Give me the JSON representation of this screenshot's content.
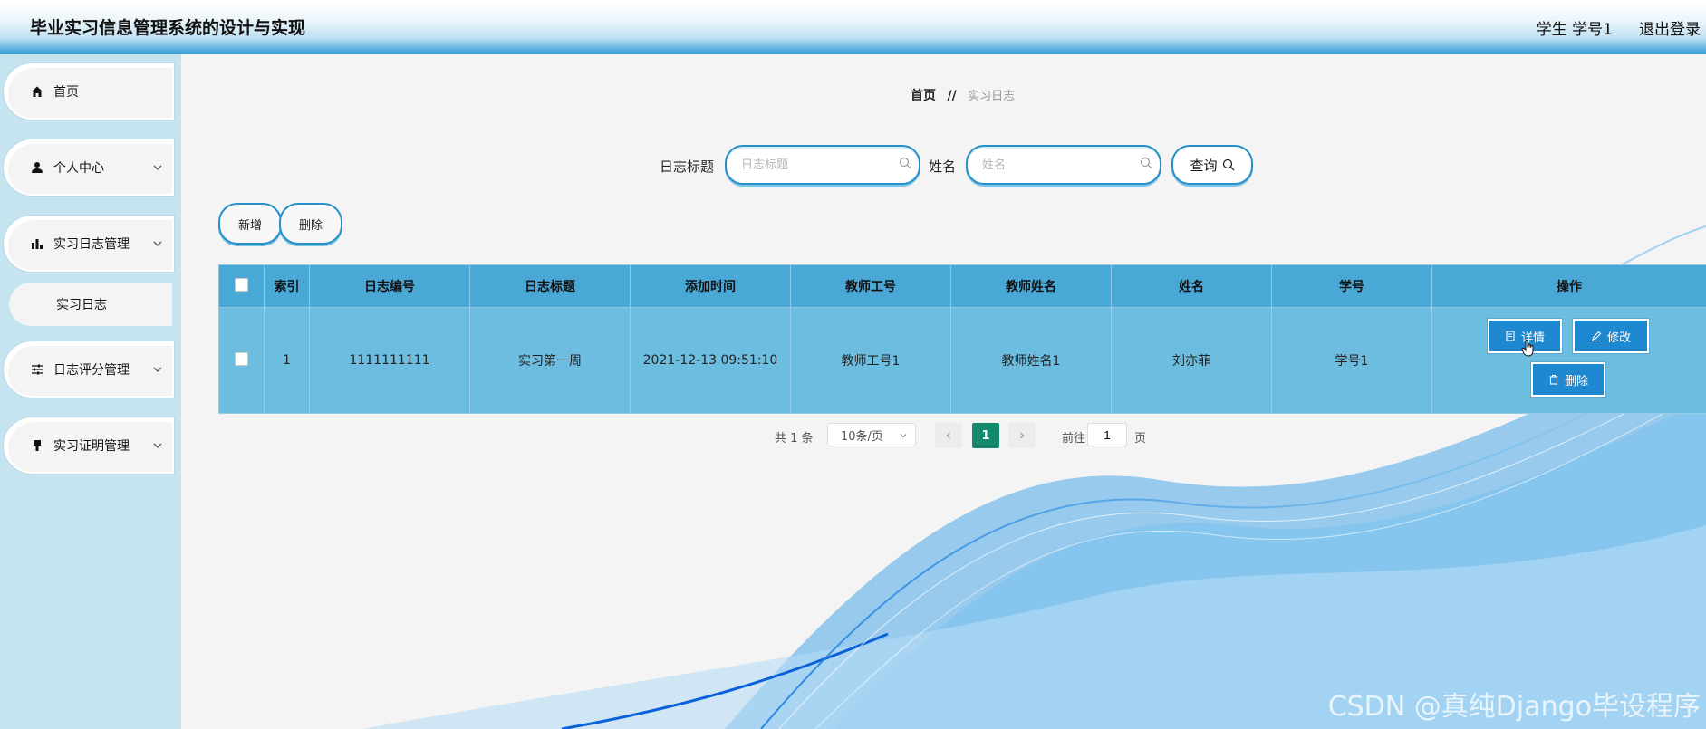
{
  "header": {
    "title": "毕业实习信息管理系统的设计与实现",
    "user": "学生 学号1",
    "logout": "退出登录"
  },
  "sidebar": {
    "items": [
      {
        "label": "首页",
        "icon": "home-icon"
      },
      {
        "label": "个人中心",
        "icon": "user-icon"
      },
      {
        "label": "实习日志管理",
        "icon": "bar-chart-icon"
      },
      {
        "label": "日志评分管理",
        "icon": "sliders-icon"
      },
      {
        "label": "实习证明管理",
        "icon": "stamp-icon"
      }
    ],
    "sub_item": "实习日志"
  },
  "breadcrumb": {
    "home": "首页",
    "separator": "//",
    "current": "实习日志"
  },
  "search": {
    "title_label": "日志标题",
    "title_placeholder": "日志标题",
    "name_label": "姓名",
    "name_placeholder": "姓名",
    "query_button": "查询"
  },
  "actions": {
    "add": "新增",
    "delete": "删除"
  },
  "table": {
    "columns": [
      "索引",
      "日志编号",
      "日志标题",
      "添加时间",
      "教师工号",
      "教师姓名",
      "姓名",
      "学号",
      "操作"
    ],
    "rows": [
      {
        "index": "1",
        "log_no": "1111111111",
        "log_title": "实习第一周",
        "added_time": "2021-12-13 09:51:10",
        "teacher_id": "教师工号1",
        "teacher_name": "教师姓名1",
        "name": "刘亦菲",
        "student_no": "学号1"
      }
    ],
    "row_actions": {
      "detail": "详情",
      "edit": "修改",
      "delete": "删除"
    }
  },
  "pagination": {
    "total": "共 1 条",
    "page_size": "10条/页",
    "current_page": "1",
    "goto_label": "前往",
    "goto_value": "1",
    "page_suffix": "页"
  },
  "watermark": "CSDN @真纯Django毕设程序",
  "colors": {
    "header_gradient_end": "#2f9ed6",
    "sidebar_bg": "#c5e4ef",
    "table_header": "#4aa8d6",
    "table_row": "#6dbde0",
    "op_button": "#1e88d0",
    "page_active": "#138a6c"
  }
}
